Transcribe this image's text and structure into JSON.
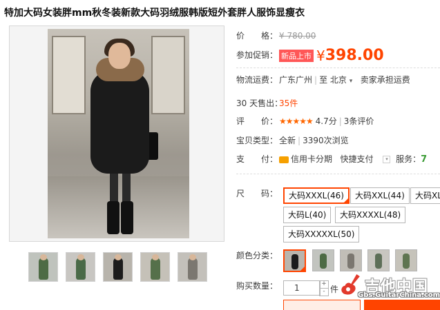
{
  "product": {
    "title": "特加大码女装胖mm秋冬装新款大码羽绒服韩版短外套胖人服饰显瘦衣"
  },
  "price": {
    "label": "价　　格：",
    "original": "¥ 780.00"
  },
  "promo": {
    "label": "参加促销：",
    "badge": "新品上市",
    "currency": "¥",
    "value": "398.00"
  },
  "shipping": {
    "label": "物流运费：",
    "from": "广东广州",
    "to_prefix": "至",
    "to": "北京",
    "note": "卖家承担运费"
  },
  "sales": {
    "label": "30 天售出：",
    "count": "35",
    "unit": "件"
  },
  "rating": {
    "label": "评　　价：",
    "stars": "★★★★★",
    "score": "4.7分",
    "reviews": "3条评价"
  },
  "status": {
    "label": "宝贝类型：",
    "type": "全新",
    "views": "3390次浏览"
  },
  "payment": {
    "label": "支　　付：",
    "method": "信用卡分期",
    "quick": "快捷支付",
    "service_label": "服务：",
    "service_icon": "7"
  },
  "size": {
    "label": "尺　　码：",
    "options": [
      "大码XXXL(46)",
      "大码XXL(44)",
      "大码XL",
      "大码L(40)",
      "大码XXXXL(48)",
      "大码XXXXXL(50)"
    ],
    "selected": 0
  },
  "color": {
    "label": "颜色分类：",
    "swatches": [
      "black",
      "green",
      "gray",
      "white",
      "khaki"
    ],
    "selected": 0
  },
  "quantity": {
    "label": "购买数量：",
    "value": "1",
    "plus": "+",
    "minus": "-",
    "unit": "件"
  },
  "watermark": {
    "name": "吉他中国",
    "url": "Gbs.GuitarChina.com"
  },
  "thumbnails": [
    "green-coat",
    "green-coat-2",
    "black-coat",
    "green-coat-3",
    "gray-coat"
  ],
  "colors": {
    "accent": "#ff4400",
    "promo_badge": "#ff5757",
    "price": "#ff4400"
  }
}
